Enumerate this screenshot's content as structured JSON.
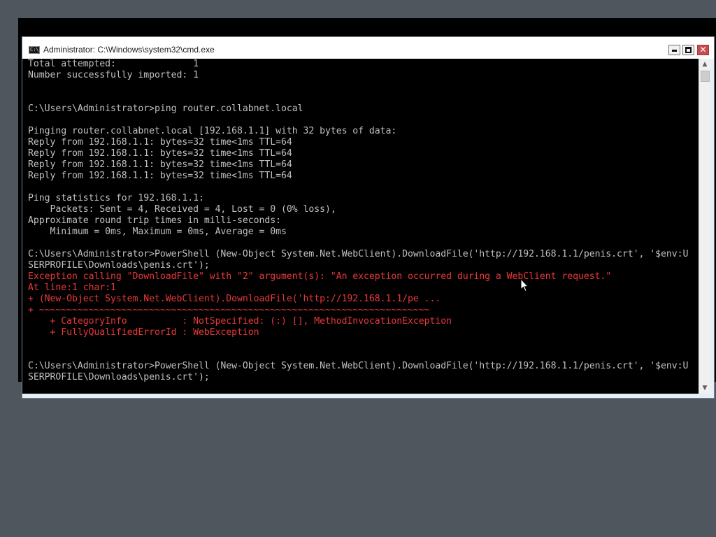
{
  "window": {
    "title": "Administrator: C:\\Windows\\system32\\cmd.exe",
    "icon": "cmd-console-icon",
    "icon_text": "C:\\"
  },
  "controls": {
    "minimize": "minimize-icon",
    "maximize": "maximize-icon",
    "close_glyph": "✕"
  },
  "colors": {
    "console_background": "#000000",
    "console_text": "#c0c0c0",
    "error_text": "#e8383a"
  },
  "console": {
    "lines": [
      {
        "text": "Total attempted:              1",
        "style": "normal"
      },
      {
        "text": "Number successfully imported: 1",
        "style": "normal"
      },
      {
        "text": "",
        "style": "normal"
      },
      {
        "text": "",
        "style": "normal"
      },
      {
        "text": "C:\\Users\\Administrator>ping router.collabnet.local",
        "style": "normal"
      },
      {
        "text": "",
        "style": "normal"
      },
      {
        "text": "Pinging router.collabnet.local [192.168.1.1] with 32 bytes of data:",
        "style": "normal"
      },
      {
        "text": "Reply from 192.168.1.1: bytes=32 time<1ms TTL=64",
        "style": "normal"
      },
      {
        "text": "Reply from 192.168.1.1: bytes=32 time<1ms TTL=64",
        "style": "normal"
      },
      {
        "text": "Reply from 192.168.1.1: bytes=32 time<1ms TTL=64",
        "style": "normal"
      },
      {
        "text": "Reply from 192.168.1.1: bytes=32 time<1ms TTL=64",
        "style": "normal"
      },
      {
        "text": "",
        "style": "normal"
      },
      {
        "text": "Ping statistics for 192.168.1.1:",
        "style": "normal"
      },
      {
        "text": "    Packets: Sent = 4, Received = 4, Lost = 0 (0% loss),",
        "style": "normal"
      },
      {
        "text": "Approximate round trip times in milli-seconds:",
        "style": "normal"
      },
      {
        "text": "    Minimum = 0ms, Maximum = 0ms, Average = 0ms",
        "style": "normal"
      },
      {
        "text": "",
        "style": "normal"
      },
      {
        "text": "C:\\Users\\Administrator>PowerShell (New-Object System.Net.WebClient).DownloadFile('http://192.168.1.1/penis.crt', '$env:U",
        "style": "normal"
      },
      {
        "text": "SERPROFILE\\Downloads\\penis.crt');",
        "style": "normal"
      },
      {
        "text": "Exception calling \"DownloadFile\" with \"2\" argument(s): \"An exception occurred during a WebClient request.\"",
        "style": "error"
      },
      {
        "text": "At line:1 char:1",
        "style": "error"
      },
      {
        "text": "+ (New-Object System.Net.WebClient).DownloadFile('http://192.168.1.1/pe ...",
        "style": "error"
      },
      {
        "text": "+ ~~~~~~~~~~~~~~~~~~~~~~~~~~~~~~~~~~~~~~~~~~~~~~~~~~~~~~~~~~~~~~~~~~~~~~~",
        "style": "error"
      },
      {
        "text": "    + CategoryInfo          : NotSpecified: (:) [], MethodInvocationException",
        "style": "error"
      },
      {
        "text": "    + FullyQualifiedErrorId : WebException",
        "style": "error"
      },
      {
        "text": "",
        "style": "normal"
      },
      {
        "text": "",
        "style": "normal"
      },
      {
        "text": "C:\\Users\\Administrator>PowerShell (New-Object System.Net.WebClient).DownloadFile('http://192.168.1.1/penis.crt', '$env:U",
        "style": "normal"
      },
      {
        "text": "SERPROFILE\\Downloads\\penis.crt');",
        "style": "normal"
      }
    ]
  },
  "scrollbar": {
    "up_glyph": "▲",
    "down_glyph": "▼",
    "thumb_position": 0
  }
}
